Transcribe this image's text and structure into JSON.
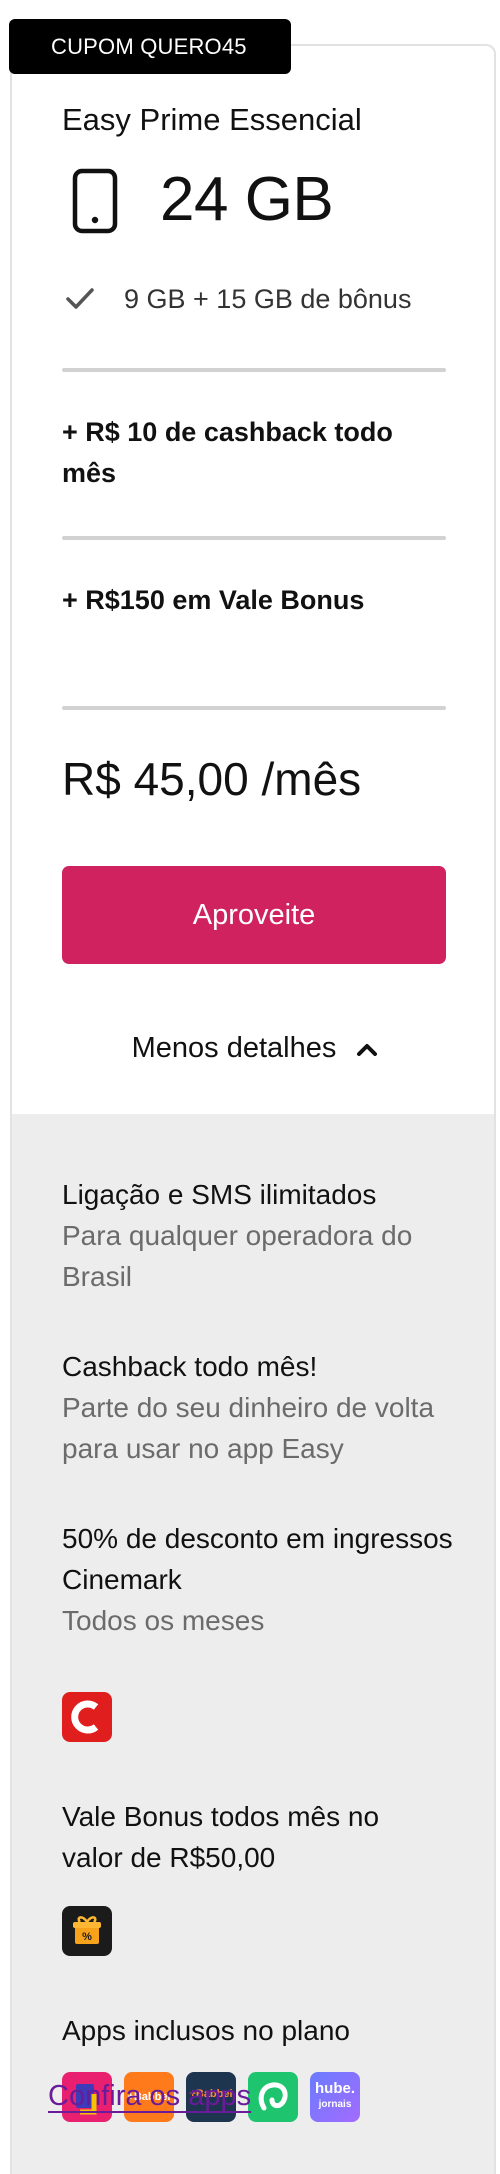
{
  "coupon": {
    "label": "CUPOM QUERO45"
  },
  "plan": {
    "name": "Easy Prime Essencial",
    "data_amount": "24 GB",
    "data_icon": "smartphone-icon",
    "bonus_breakdown": "9 GB + 15 GB de bônus",
    "bonus_icon": "check-icon"
  },
  "perks": [
    {
      "label": "+ R$ 10 de cashback todo mês"
    },
    {
      "label": "+ R$150 em Vale Bonus"
    }
  ],
  "price": {
    "label": "R$ 45,00 /mês"
  },
  "cta": {
    "label": "Aproveite",
    "color": "#d0225f"
  },
  "details_toggle": {
    "label": "Menos detalhes",
    "icon": "chevron-up-icon"
  },
  "details": {
    "calls": {
      "title": "Ligação e SMS ilimitados",
      "subtitle": "Para qualquer operadora do Brasil"
    },
    "cashback": {
      "title": "Cashback todo mês!",
      "subtitle": "Parte do seu dinheiro de volta para usar no app Easy"
    },
    "cinemark": {
      "title": "50% de desconto em ingressos Cinemark",
      "subtitle": "Todos os meses",
      "icon": "cinemark-icon"
    },
    "vale_bonus": {
      "title": "Vale Bonus todos mês no valor de R$50,00",
      "icon": "gift-box-icon"
    },
    "apps": {
      "title": "Apps inclusos no plano",
      "icons": [
        "bookshelf-app-icon",
        "babbel-app-icon",
        "babbel-business-app-icon",
        "pet-app-icon",
        "hube-jornais-app-icon"
      ],
      "babbel_label": "+Babbel",
      "babbel2_label": "+Babbel",
      "hube_label_1": "hube.",
      "hube_label_2": "jornais",
      "link": "Confira os apps"
    }
  }
}
